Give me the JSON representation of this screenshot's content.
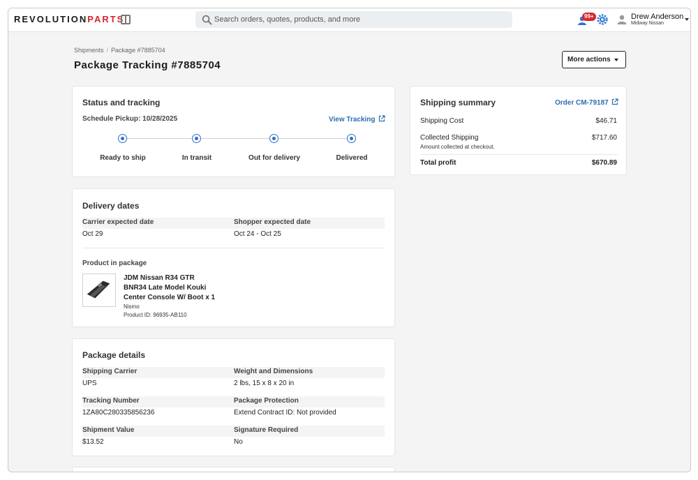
{
  "brand": {
    "logo_part1": "REVOLUTION",
    "logo_part2": "PARTS",
    "accent": "#d6262d",
    "link": "#2a6fb0"
  },
  "topbar": {
    "search_placeholder": "Search orders, quotes, products, and more",
    "notif_badge": "99+",
    "user_name": "Drew Anderson",
    "user_org": "Midway Nissan"
  },
  "breadcrumb": {
    "item1": "Shipments",
    "sep": "/",
    "item2": "Package #7885704"
  },
  "page": {
    "title": "Package Tracking #7885704",
    "more_actions": "More actions"
  },
  "status": {
    "title": "Status and tracking",
    "pickup": "Schedule Pickup: 10/28/2025",
    "view_tracking": "View Tracking",
    "steps": [
      "Ready to ship",
      "In transit",
      "Out for delivery",
      "Delivered"
    ]
  },
  "delivery": {
    "title": "Delivery dates",
    "carrier_label": "Carrier expected date",
    "carrier_value": "Oct 29",
    "shopper_label": "Shopper expected date",
    "shopper_value": "Oct 24 - Oct 25",
    "product_label": "Product in package",
    "product_line1": "JDM Nissan R34 GTR",
    "product_line2": "BNR34 Late Model Kouki",
    "product_line3": "Center Console W/ Boot x 1",
    "product_brand": "Nismo",
    "product_id": "Product ID: 96935-AB110"
  },
  "package": {
    "title": "Package details",
    "rows": [
      {
        "l1": "Shipping Carrier",
        "v1": "UPS",
        "l2": "Weight and Dimensions",
        "v2": "2 lbs, 15 x 8 x 20 in"
      },
      {
        "l1": "Tracking Number",
        "v1": "1ZA80C280335856236",
        "l2": "Package Protection",
        "v2": "Extend Contract ID: Not provided"
      },
      {
        "l1": "Shipment Value",
        "v1": "$13.52",
        "l2": "Signature Required",
        "v2": "No"
      }
    ]
  },
  "summary": {
    "title": "Shipping summary",
    "order_link": "Order CM-79187",
    "shipping_cost_label": "Shipping Cost",
    "shipping_cost": "$46.71",
    "collected_label": "Collected Shipping",
    "collected_value": "$717.60",
    "collected_note": "Amount collected at checkout.",
    "profit_label": "Total profit",
    "profit_value": "$670.89"
  }
}
